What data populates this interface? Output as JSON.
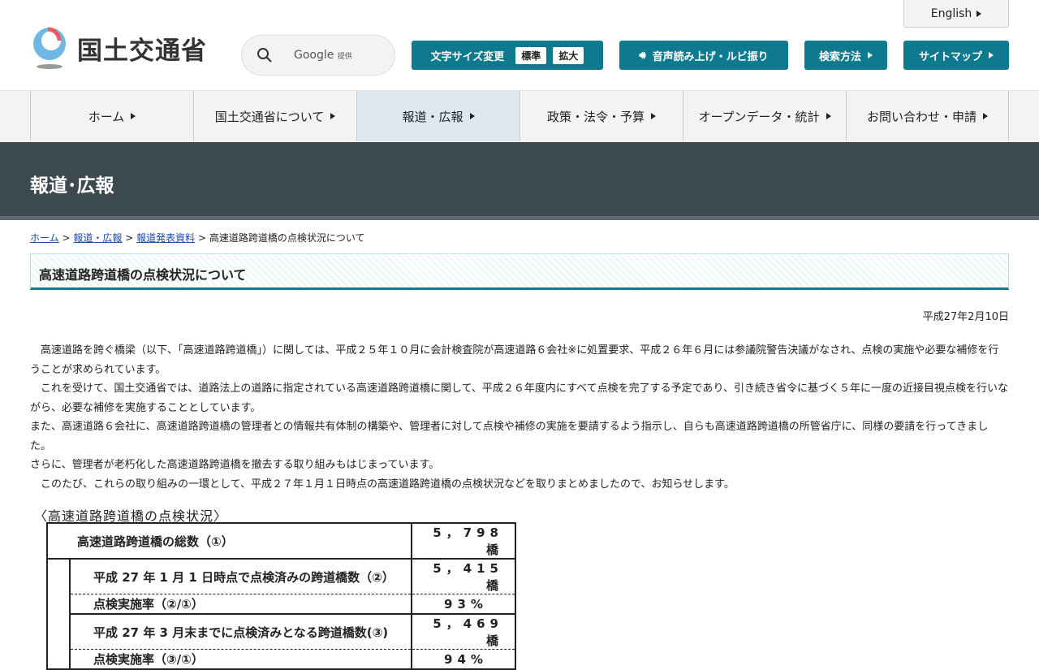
{
  "header": {
    "english": "English",
    "logo": "国土交通省",
    "search_label": "Google",
    "search_sub": "提供",
    "font_size_label": "文字サイズ変更",
    "font_std": "標準",
    "font_large": "拡大",
    "speech": "音声読み上げ・ルビ振り",
    "search_method": "検索方法",
    "sitemap": "サイトマップ"
  },
  "nav": [
    {
      "label": "ホーム"
    },
    {
      "label": "国土交通省について"
    },
    {
      "label": "報道・広報"
    },
    {
      "label": "政策・法令・予算"
    },
    {
      "label": "オープンデータ・統計"
    },
    {
      "label": "お問い合わせ・申請"
    }
  ],
  "banner": "報道･広報",
  "breadcrumb": {
    "home": "ホーム",
    "press": "報道・広報",
    "releases": "報道発表資料",
    "current": "高速道路跨道橋の点検状況について",
    "sep": ">"
  },
  "title": "高速道路跨道橋の点検状況について",
  "date": "平成27年2月10日",
  "paragraphs": [
    "　高速道路を跨ぐ橋梁（以下、「高速道路跨道橋」）に関しては、平成２５年１０月に会計検査院が高速道路６会社※に処置要求、平成２６年６月には参議院警告決議がなされ、点検の実施や必要な補修を行うことが求められています。",
    "　これを受けて、国土交通省では、道路法上の道路に指定されている高速道路跨道橋に関して、平成２６年度内にすべて点検を完了する予定であり、引き続き省令に基づく５年に一度の近接目視点検を行いながら、必要な補修を実施することとしています。",
    "また、高速道路６会社に、高速道路跨道橋の管理者との情報共有体制の構築や、管理者に対して点検や補修の実施を要請するよう指示し、自らも高速道路跨道橋の所管省庁に、同様の要請を行ってきました。",
    "さらに、管理者が老朽化した高速道路跨道橋を撤去する取り組みもはじまっています。",
    "　このたび、これらの取り組みの一環として、平成２７年１月１日時点の高速道路跨道橋の点検状況などを取りまとめましたので、お知らせします。"
  ],
  "table": {
    "caption": "〈高速道路跨道橋の点検状況〉",
    "rows": [
      {
        "label": "高速道路跨道橋の総数（①）",
        "value": "5，798橋"
      },
      {
        "label": "平成 27 年 1 月 1 日時点で点検済みの跨道橋数（②）",
        "value": "5，415橋"
      },
      {
        "label": "点検実施率（②/①）",
        "value": "93%"
      },
      {
        "label": "平成 27 年 3 月末までに点検済みとなる跨道橋数(③)",
        "value": "5，469橋"
      },
      {
        "label": "点検実施率（③/①）",
        "value": "94%"
      }
    ]
  }
}
